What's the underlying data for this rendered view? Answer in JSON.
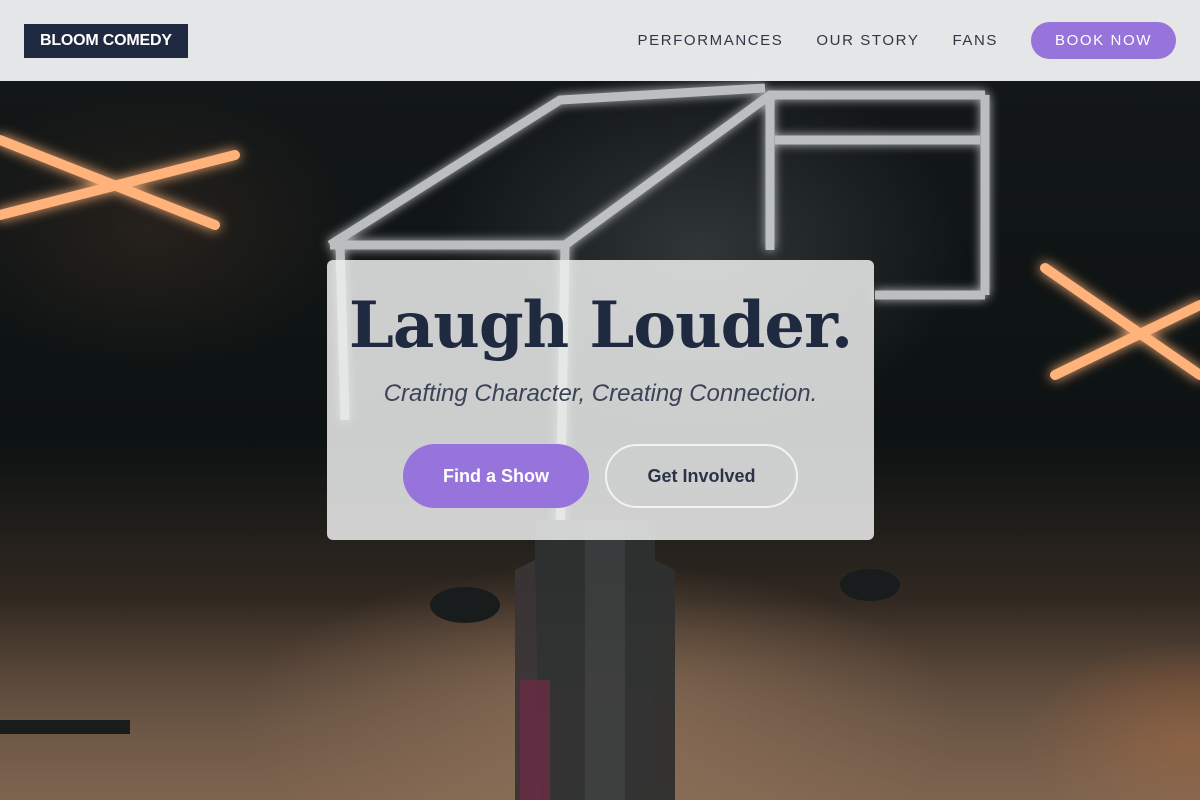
{
  "nav": {
    "logo": "BLOOM COMEDY",
    "links": [
      "PERFORMANCES",
      "OUR STORY",
      "FANS"
    ],
    "cta": "BOOK NOW"
  },
  "hero": {
    "headline": "Laugh Louder.",
    "tagline": "Crafting Character, Creating Connection.",
    "primary_button": "Find a Show",
    "secondary_button": "Get Involved"
  },
  "colors": {
    "brand_navy": "#1f2940",
    "accent_purple": "#9773dc",
    "nav_background": "#ecedee"
  }
}
